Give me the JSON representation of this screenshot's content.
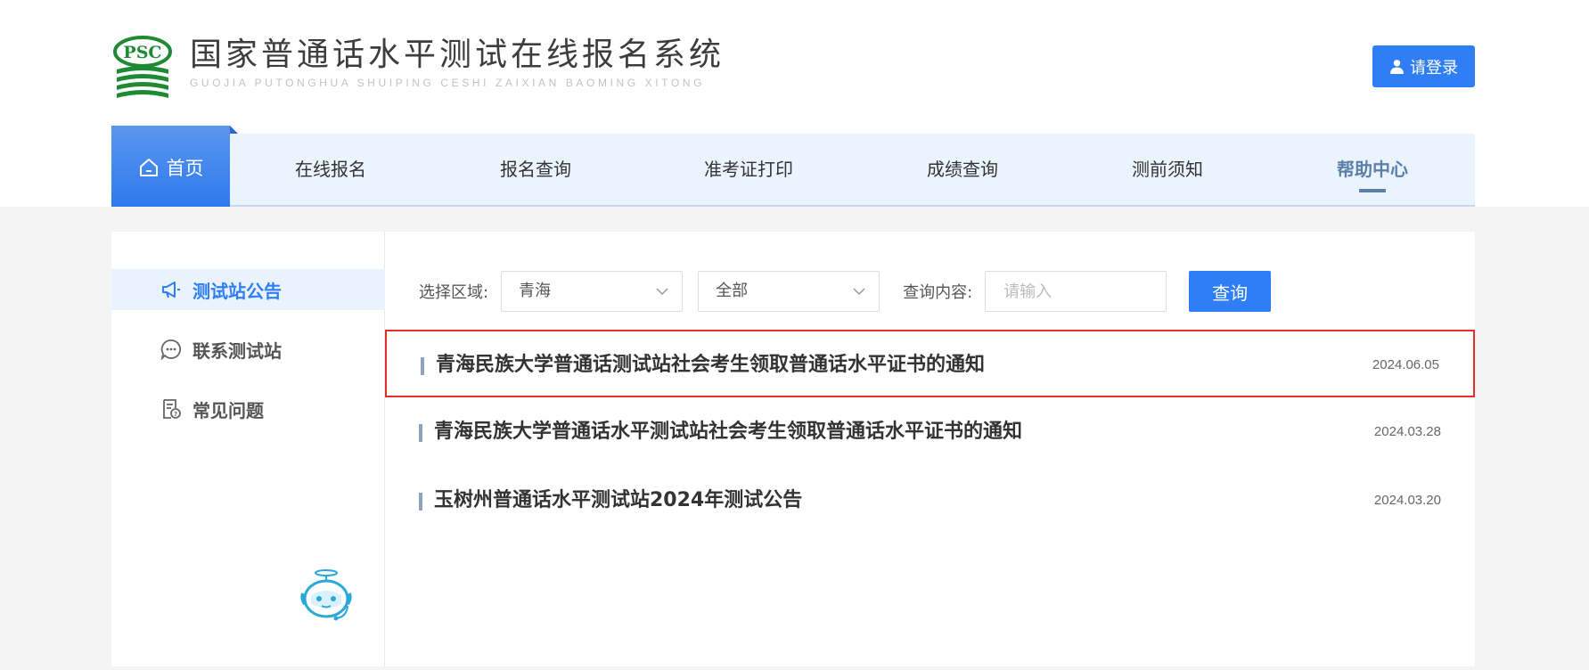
{
  "header": {
    "title": "国家普通话水平测试在线报名系统",
    "pinyin": "GUOJIA PUTONGHUA SHUIPING CESHI ZAIXIAN BAOMING XITONG",
    "logo_text": "PSC",
    "login_label": "请登录"
  },
  "nav": {
    "home": "首页",
    "items": [
      "在线报名",
      "报名查询",
      "准考证打印",
      "成绩查询",
      "测前须知",
      "帮助中心"
    ],
    "active": "帮助中心"
  },
  "sidebar": {
    "items": [
      {
        "label": "测试站公告",
        "icon": "megaphone-icon",
        "active": true
      },
      {
        "label": "联系测试站",
        "icon": "chat-icon",
        "active": false
      },
      {
        "label": "常见问题",
        "icon": "faq-document-icon",
        "active": false
      }
    ]
  },
  "filter": {
    "region_label": "选择区域:",
    "region_value": "青海",
    "scope_value": "全部",
    "query_label": "查询内容:",
    "query_placeholder": "请输入",
    "query_value": "",
    "query_button": "查询"
  },
  "notices": [
    {
      "title": "青海民族大学普通话测试站社会考生领取普通话水平证书的通知",
      "date": "2024.06.05",
      "highlighted": true
    },
    {
      "title": "青海民族大学普通话水平测试站社会考生领取普通话水平证书的通知",
      "date": "2024.03.28",
      "highlighted": false
    },
    {
      "title": "玉树州普通话水平测试站2024年测试公告",
      "date": "2024.03.20",
      "highlighted": false
    }
  ],
  "colors": {
    "accent": "#2f7ef5",
    "nav_bg": "#ebf3fd",
    "highlight_border": "#e0312a",
    "logo_green": "#1f8a34"
  }
}
